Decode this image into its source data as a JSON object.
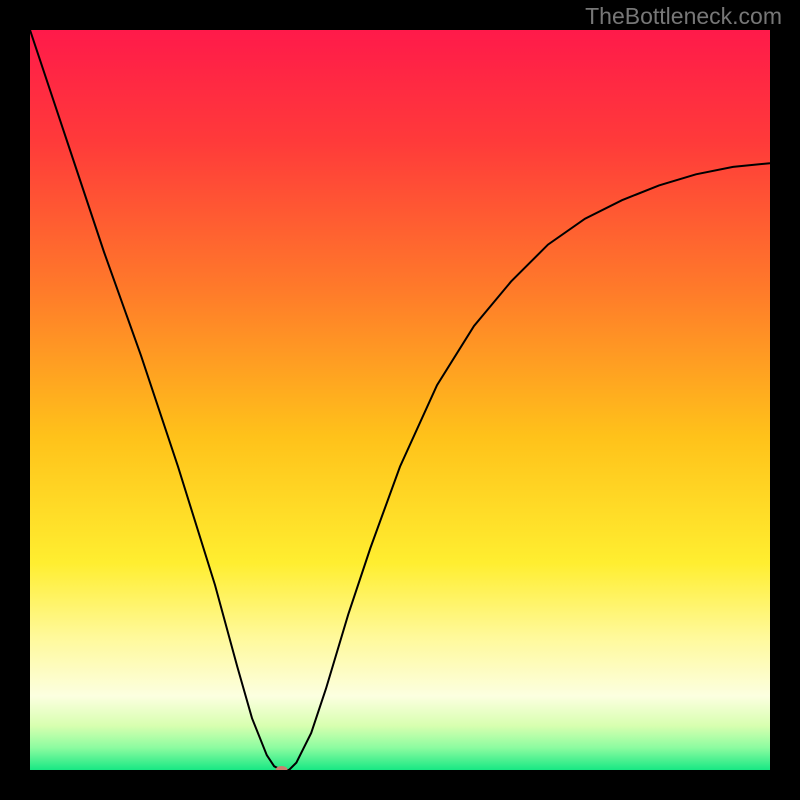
{
  "watermark": "TheBottleneck.com",
  "chart_data": {
    "type": "line",
    "title": "",
    "xlabel": "",
    "ylabel": "",
    "xlim": [
      0,
      100
    ],
    "ylim": [
      0,
      100
    ],
    "grid": false,
    "background_gradient": {
      "stops": [
        {
          "offset": 0,
          "color": "#ff1a4a"
        },
        {
          "offset": 15,
          "color": "#ff3a3a"
        },
        {
          "offset": 35,
          "color": "#ff7a2a"
        },
        {
          "offset": 55,
          "color": "#ffc21a"
        },
        {
          "offset": 72,
          "color": "#ffee30"
        },
        {
          "offset": 82,
          "color": "#fff99a"
        },
        {
          "offset": 90,
          "color": "#fcffe0"
        },
        {
          "offset": 94,
          "color": "#d8ffb0"
        },
        {
          "offset": 97,
          "color": "#8cfca0"
        },
        {
          "offset": 100,
          "color": "#18e884"
        }
      ]
    },
    "series": [
      {
        "name": "bottleneck-curve",
        "color": "#000000",
        "x": [
          0,
          5,
          10,
          15,
          20,
          25,
          28,
          30,
          32,
          33,
          34,
          35,
          36,
          38,
          40,
          43,
          46,
          50,
          55,
          60,
          65,
          70,
          75,
          80,
          85,
          90,
          95,
          100
        ],
        "y": [
          100,
          85,
          70,
          56,
          41,
          25,
          14,
          7,
          2,
          0.5,
          0,
          0,
          1,
          5,
          11,
          21,
          30,
          41,
          52,
          60,
          66,
          71,
          74.5,
          77,
          79,
          80.5,
          81.5,
          82
        ]
      }
    ],
    "marker": {
      "x": 34,
      "y": 0,
      "color": "#c88070",
      "rx": 6,
      "ry": 4
    }
  }
}
